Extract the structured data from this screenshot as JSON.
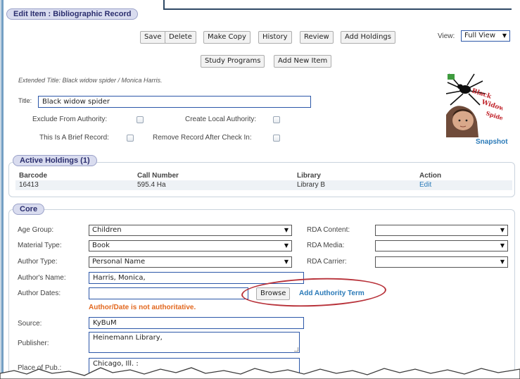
{
  "header": {
    "title": "Edit Item : Bibliographic Record"
  },
  "toolbar": {
    "save": "Save",
    "delete": "Delete",
    "make_copy": "Make Copy",
    "history": "History",
    "review": "Review",
    "add_holdings": "Add Holdings",
    "study_programs": "Study Programs",
    "add_new_item": "Add New Item",
    "view_label": "View:",
    "view_value": "Full View"
  },
  "record": {
    "extended_title": "Extended Title: Black widow spider / Monica Harris.",
    "title_label": "Title:",
    "title_value": "Black widow spider",
    "exclude_authority": "Exclude From Authority:",
    "create_local_authority": "Create Local Authority:",
    "brief_record": "This Is A Brief Record:",
    "remove_after_checkin": "Remove Record After Check In:",
    "snapshot": "Snapshot",
    "cover_text": "Black Widow Spider"
  },
  "holdings": {
    "title": "Active Holdings (1)",
    "headers": {
      "barcode": "Barcode",
      "call_number": "Call Number",
      "library": "Library",
      "action": "Action"
    },
    "rows": [
      {
        "barcode": "16413",
        "call_number": "595.4 Ha",
        "library": "Library B",
        "action": "Edit"
      }
    ]
  },
  "core": {
    "title": "Core",
    "age_group_label": "Age Group:",
    "age_group_value": "Children",
    "material_type_label": "Material Type:",
    "material_type_value": "Book",
    "author_type_label": "Author Type:",
    "author_type_value": "Personal Name",
    "authors_name_label": "Author's Name:",
    "authors_name_value": "Harris, Monica,",
    "author_dates_label": "Author Dates:",
    "author_dates_value": "",
    "browse": "Browse",
    "add_authority_term": "Add Authority Term",
    "authority_error": "Author/Date is not authoritative.",
    "rda_content_label": "RDA Content:",
    "rda_content_value": "",
    "rda_media_label": "RDA Media:",
    "rda_media_value": "",
    "rda_carrier_label": "RDA Carrier:",
    "rda_carrier_value": "",
    "source_label": "Source:",
    "source_value": "KyBuM",
    "publisher_label": "Publisher:",
    "publisher_value": "Heinemann Library,",
    "place_label": "Place of Pub.:",
    "place_value": "Chicago, Ill. :"
  },
  "colors": {
    "accent": "#2a7ab8",
    "error": "#e2681f",
    "highlight": "#b8323a",
    "tab": "#d9dcef"
  }
}
